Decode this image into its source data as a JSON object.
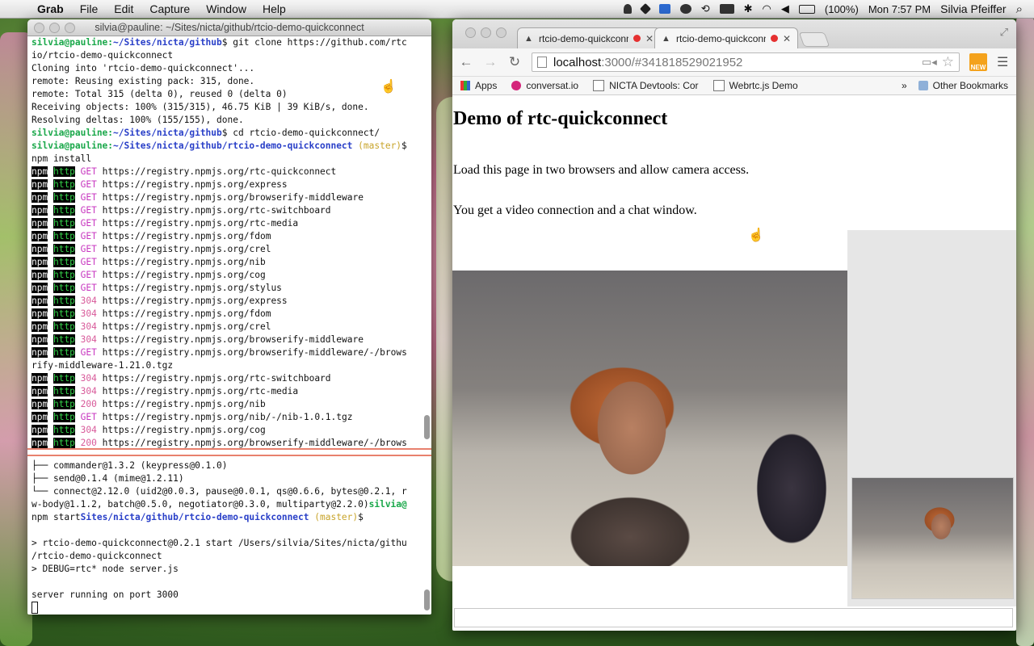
{
  "menubar": {
    "app": "Grab",
    "menus": [
      "File",
      "Edit",
      "Capture",
      "Window",
      "Help"
    ],
    "battery": "(100%)",
    "clock": "Mon 7:57 PM",
    "user": "Silvia Pfeiffer"
  },
  "terminal": {
    "title": "silvia@pauline: ~/Sites/nicta/github/rtcio-demo-quickconnect",
    "lines_top": [
      {
        "type": "prompt",
        "user": "silvia@pauline",
        "path": "~/Sites/nicta/github",
        "cmd": "$ git clone https://github.com/rtc"
      },
      {
        "type": "text",
        "text": "io/rtcio-demo-quickconnect"
      },
      {
        "type": "text",
        "text": "Cloning into 'rtcio-demo-quickconnect'..."
      },
      {
        "type": "text",
        "text": "remote: Reusing existing pack: 315, done."
      },
      {
        "type": "text",
        "text": "remote: Total 315 (delta 0), reused 0 (delta 0)"
      },
      {
        "type": "text",
        "text": "Receiving objects: 100% (315/315), 46.75 KiB | 39 KiB/s, done."
      },
      {
        "type": "text",
        "text": "Resolving deltas: 100% (155/155), done."
      },
      {
        "type": "prompt",
        "user": "silvia@pauline",
        "path": "~/Sites/nicta/github",
        "cmd": "$ cd rtcio-demo-quickconnect/"
      },
      {
        "type": "prompt",
        "user": "silvia@pauline",
        "path": "~/Sites/nicta/github/rtcio-demo-quickconnect",
        "git": " (master)",
        "cmd": "$"
      },
      {
        "type": "text",
        "text": "npm install"
      },
      {
        "type": "npm",
        "code": "GET",
        "url": "https://registry.npmjs.org/rtc-quickconnect"
      },
      {
        "type": "npm",
        "code": "GET",
        "url": "https://registry.npmjs.org/express"
      },
      {
        "type": "npm",
        "code": "GET",
        "url": "https://registry.npmjs.org/browserify-middleware"
      },
      {
        "type": "npm",
        "code": "GET",
        "url": "https://registry.npmjs.org/rtc-switchboard"
      },
      {
        "type": "npm",
        "code": "GET",
        "url": "https://registry.npmjs.org/rtc-media"
      },
      {
        "type": "npm",
        "code": "GET",
        "url": "https://registry.npmjs.org/fdom"
      },
      {
        "type": "npm",
        "code": "GET",
        "url": "https://registry.npmjs.org/crel"
      },
      {
        "type": "npm",
        "code": "GET",
        "url": "https://registry.npmjs.org/nib"
      },
      {
        "type": "npm",
        "code": "GET",
        "url": "https://registry.npmjs.org/cog"
      },
      {
        "type": "npm",
        "code": "GET",
        "url": "https://registry.npmjs.org/stylus"
      },
      {
        "type": "npm",
        "code": "304",
        "url": "https://registry.npmjs.org/express"
      },
      {
        "type": "npm",
        "code": "304",
        "url": "https://registry.npmjs.org/fdom"
      },
      {
        "type": "npm",
        "code": "304",
        "url": "https://registry.npmjs.org/crel"
      },
      {
        "type": "npm",
        "code": "304",
        "url": "https://registry.npmjs.org/browserify-middleware"
      },
      {
        "type": "npm",
        "code": "GET",
        "url": "https://registry.npmjs.org/browserify-middleware/-/brows"
      },
      {
        "type": "text",
        "text": "rify-middleware-1.21.0.tgz"
      },
      {
        "type": "npm",
        "code": "304",
        "url": "https://registry.npmjs.org/rtc-switchboard"
      },
      {
        "type": "npm",
        "code": "304",
        "url": "https://registry.npmjs.org/rtc-media"
      },
      {
        "type": "npm",
        "code": "200",
        "url": "https://registry.npmjs.org/nib"
      },
      {
        "type": "npm",
        "code": "GET",
        "url": "https://registry.npmjs.org/nib/-/nib-1.0.1.tgz"
      },
      {
        "type": "npm",
        "code": "304",
        "url": "https://registry.npmjs.org/cog"
      },
      {
        "type": "npm",
        "code": "200",
        "url": "https://registry.npmjs.org/browserify-middleware/-/brows"
      }
    ],
    "lines_bottom": [
      {
        "type": "text",
        "text": "├── commander@1.3.2 (keypress@0.1.0)"
      },
      {
        "type": "text",
        "text": "├── send@0.1.4 (mime@1.2.11)"
      },
      {
        "type": "text",
        "text": "└── connect@2.12.0 (uid2@0.0.3, pause@0.0.1, qs@0.6.6, bytes@0.2.1, r"
      },
      {
        "type": "tail",
        "text": "w-body@1.1.2, batch@0.5.0, negotiator@0.3.0, multiparty@2.2.0)",
        "user": "silvia@"
      },
      {
        "type": "startprompt",
        "pre": "npm start",
        "path": "Sites/nicta/github/rtcio-demo-quickconnect",
        "git": " (master)",
        "cmd": "$"
      },
      {
        "type": "text",
        "text": ""
      },
      {
        "type": "text",
        "text": "> rtcio-demo-quickconnect@0.2.1 start /Users/silvia/Sites/nicta/githu"
      },
      {
        "type": "text",
        "text": "/rtcio-demo-quickconnect"
      },
      {
        "type": "text",
        "text": "> DEBUG=rtc* node server.js"
      },
      {
        "type": "text",
        "text": ""
      },
      {
        "type": "text",
        "text": "server running on port 3000"
      }
    ],
    "npm_label": "npm",
    "http_label": "http"
  },
  "browser": {
    "tabs": [
      {
        "label": "rtcio-demo-quickconne"
      },
      {
        "label": "rtcio-demo-quickconne"
      }
    ],
    "address": {
      "host": "localhost",
      "rest": ":3000/#341818529021952"
    },
    "new_badge": "NEW",
    "bookmarks": [
      {
        "label": "Apps",
        "icon": "apps-grid-icon"
      },
      {
        "label": "conversat.io",
        "icon": "conversat-icon"
      },
      {
        "label": "NICTA Devtools: Cor",
        "icon": "page-icon"
      },
      {
        "label": "Webrtc.js Demo",
        "icon": "page-icon"
      }
    ],
    "bookmarks_more": "»",
    "other_bookmarks": "Other Bookmarks",
    "page": {
      "heading": "Demo of rtc-quickconnect",
      "para1": "Load this page in two browsers and allow camera access.",
      "para2": "You get a video connection and a chat window."
    }
  }
}
